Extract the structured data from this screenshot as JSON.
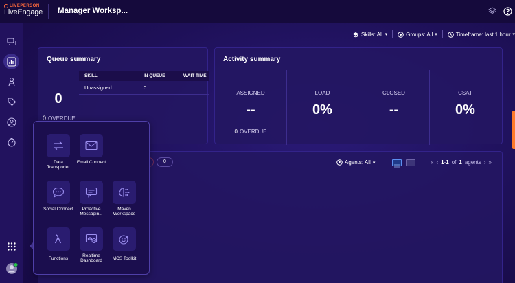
{
  "header": {
    "brand": "LIVEPERSON",
    "product": "LiveEngage",
    "title": "Manager Worksp..."
  },
  "filters": {
    "skills": "Skills: All",
    "groups": "Groups: All",
    "timeframe": "Timeframe: last 1 hour"
  },
  "queue_summary": {
    "title": "Queue summary",
    "total": "0",
    "overdue_count": "0",
    "overdue_label": "OVERDUE",
    "columns": [
      "SKILL",
      "IN QUEUE",
      "WAIT TIME"
    ],
    "rows": [
      {
        "skill": "Unassigned",
        "in_queue": "0",
        "wait_time": ""
      }
    ]
  },
  "activity_summary": {
    "title": "Activity summary",
    "cells": [
      {
        "label": "ASSIGNED",
        "value": "--"
      },
      {
        "label": "LOAD",
        "value": "0%"
      },
      {
        "label": "CLOSED",
        "value": "--"
      },
      {
        "label": "CSAT",
        "value": "0%"
      }
    ],
    "overdue_count": "0",
    "overdue_label": "OVERDUE"
  },
  "agents": {
    "filter": "Agents: All",
    "pager_prefix": "1-1",
    "pager_of": "of",
    "pager_count": "1",
    "pager_suffix": "agents",
    "partial_value": "0"
  },
  "apps": [
    {
      "name": "Data Transporter",
      "icon": "arrows-swap-icon"
    },
    {
      "name": "Email Connect",
      "icon": "envelope-icon"
    },
    {
      "name": "Social Connect",
      "icon": "chat-bubble-icon"
    },
    {
      "name": "Proactive Messagin...",
      "icon": "message-icon"
    },
    {
      "name": "Maven Workspace",
      "icon": "brain-icon"
    },
    {
      "name": "Functions",
      "icon": "lambda-icon"
    },
    {
      "name": "Realtime Dashboard",
      "icon": "dashboard-icon"
    },
    {
      "name": "MCS Toolkit",
      "icon": "face-heart-icon"
    }
  ],
  "colors": {
    "accent": "#ff6a3d",
    "background": "#1a0f4a",
    "panel": "#241662",
    "status_online": "#29c24a"
  }
}
